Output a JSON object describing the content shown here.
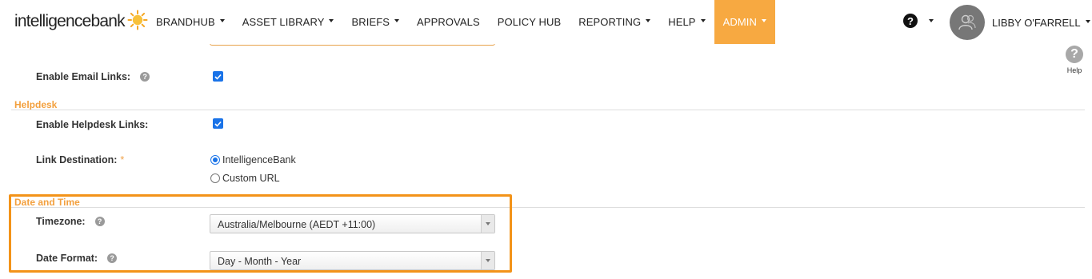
{
  "brand": {
    "logo_text": "intelligencebank",
    "accent": "#f7a941",
    "highlight": "#f39319"
  },
  "nav": {
    "items": [
      {
        "label": "BRANDHUB",
        "caret": true
      },
      {
        "label": "ASSET LIBRARY",
        "caret": true
      },
      {
        "label": "BRIEFS",
        "caret": true
      },
      {
        "label": "APPROVALS",
        "caret": false
      },
      {
        "label": "POLICY HUB",
        "caret": false
      },
      {
        "label": "REPORTING",
        "caret": true
      },
      {
        "label": "HELP",
        "caret": true
      },
      {
        "label": "ADMIN",
        "caret": true,
        "active": true
      }
    ],
    "help_symbol": "?",
    "user_name": "LIBBY O'FARRELL"
  },
  "help_side": {
    "symbol": "?",
    "label": "Help"
  },
  "form": {
    "email_links_label": "Enable Email Links:",
    "info_symbol": "?",
    "helpdesk_section": "Helpdesk",
    "helpdesk_links_label": "Enable Helpdesk Links:",
    "link_destination_label": "Link Destination:",
    "required_mark": "*",
    "link_destination_options": [
      "IntelligenceBank",
      "Custom URL"
    ],
    "link_destination_selected": "IntelligenceBank",
    "datetime_section": "Date and Time",
    "timezone_label": "Timezone:",
    "timezone_value": "Australia/Melbourne (AEDT +11:00)",
    "date_format_label": "Date Format:",
    "date_format_value": "Day - Month - Year"
  },
  "icons": {
    "help": "question-circle-icon",
    "info": "info-question-icon",
    "checkbox": "checkmark-icon",
    "dropdown": "chevron-down-icon"
  }
}
